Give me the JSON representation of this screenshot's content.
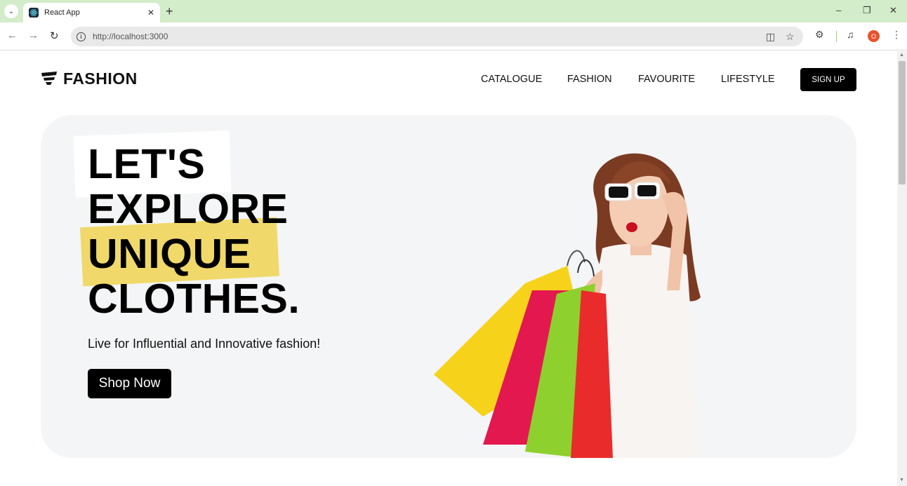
{
  "browser": {
    "tab_title": "React App",
    "url": "http://localhost:3000",
    "profile_initial": "O"
  },
  "header": {
    "logo_text": "FASHION",
    "nav": [
      "CATALOGUE",
      "FASHION",
      "FAVOURITE",
      "LIFESTYLE"
    ],
    "signup_label": "SIGN UP"
  },
  "hero": {
    "headline": [
      "LET'S",
      "EXPLORE",
      "UNIQUE",
      "CLOTHES."
    ],
    "tagline": "Live for Influential and Innovative fashion!",
    "cta_label": "Shop Now"
  },
  "colors": {
    "tabbar_bg": "#d3ecc9",
    "highlight_yellow": "#f0d96a",
    "hero_bg": "#f4f5f6",
    "button_black": "#000000"
  }
}
